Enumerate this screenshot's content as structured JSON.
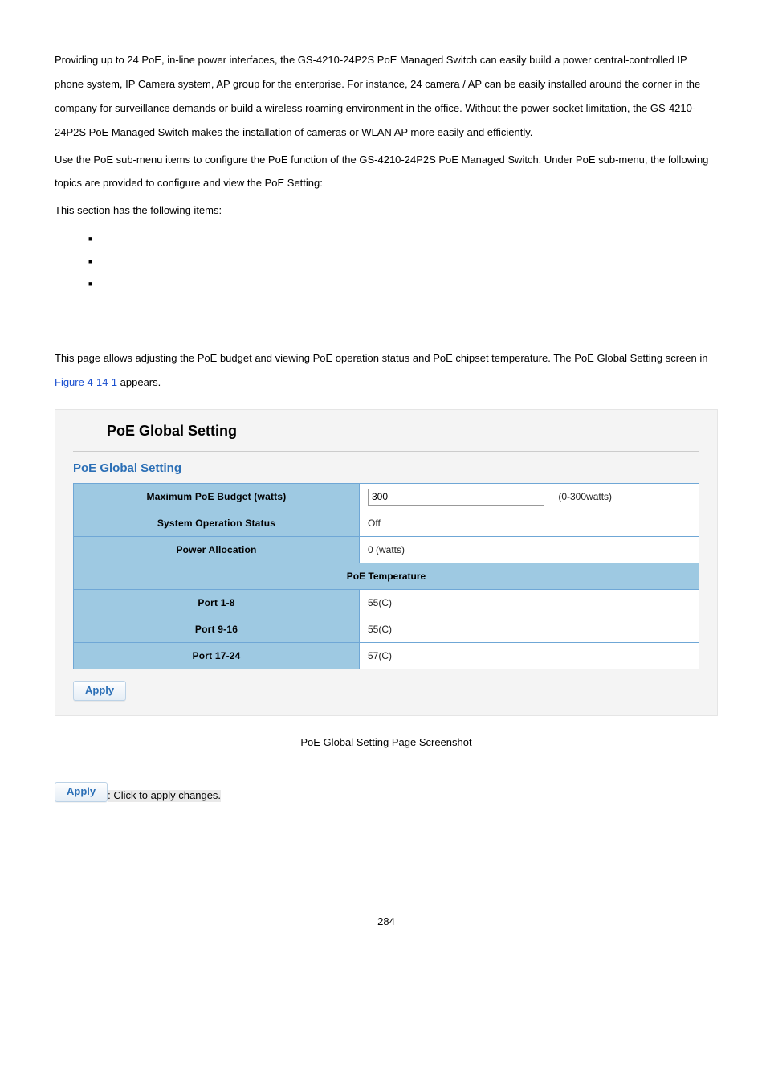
{
  "intro": {
    "p1": "Providing up to 24 PoE, in-line power interfaces, the GS-4210-24P2S PoE Managed Switch can easily build a power central-controlled IP phone system, IP Camera system, AP group for the enterprise. For instance, 24 camera / AP can be easily installed around the corner in the company for surveillance demands or build a wireless roaming environment in the office. Without the power-socket limitation, the GS-4210-24P2S PoE Managed Switch makes the installation of cameras or WLAN AP more easily and efficiently.",
    "p2": "Use the PoE sub-menu items to configure the PoE function of the GS-4210-24P2S PoE Managed Switch. Under PoE sub-menu, the following topics are provided to configure and view the PoE Setting:",
    "p3": "This section has the following items:"
  },
  "section2": {
    "text1": "This page allows adjusting the PoE budget and viewing PoE operation status and PoE chipset temperature. The PoE Global Setting screen in ",
    "figref": "Figure 4-14-1",
    "text2": " appears."
  },
  "panel": {
    "title": "PoE Global Setting",
    "subtitle": "PoE Global Setting",
    "rows": {
      "budget_label": "Maximum PoE Budget (watts)",
      "budget_value": "300",
      "budget_range": "(0-300watts)",
      "status_label": "System Operation Status",
      "status_value": "Off",
      "alloc_label": "Power Allocation",
      "alloc_value": "0 (watts)",
      "temp_header": "PoE Temperature",
      "port1_label": "Port 1-8",
      "port1_value": "55(C)",
      "port2_label": "Port 9-16",
      "port2_value": "55(C)",
      "port3_label": "Port 17-24",
      "port3_value": "57(C)"
    },
    "apply": "Apply"
  },
  "caption": "PoE Global Setting Page Screenshot",
  "apply_desc": ": Click to apply changes.",
  "page_number": "284"
}
